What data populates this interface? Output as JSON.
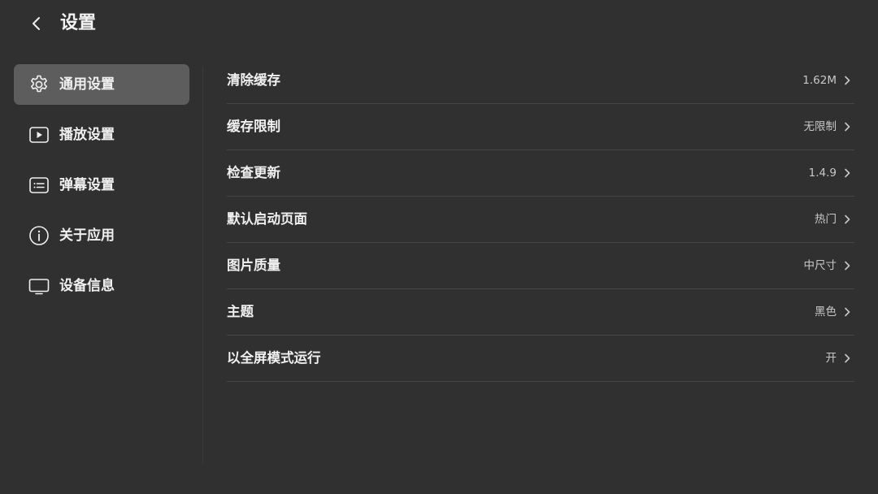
{
  "header": {
    "title": "设置"
  },
  "sidebar": {
    "items": [
      {
        "label": "通用设置",
        "icon": "gear-icon",
        "active": true
      },
      {
        "label": "播放设置",
        "icon": "play-icon",
        "active": false
      },
      {
        "label": "弹幕设置",
        "icon": "danmaku-icon",
        "active": false
      },
      {
        "label": "关于应用",
        "icon": "info-icon",
        "active": false
      },
      {
        "label": "设备信息",
        "icon": "monitor-icon",
        "active": false
      }
    ]
  },
  "settings": {
    "rows": [
      {
        "label": "清除缓存",
        "value": "1.62M"
      },
      {
        "label": "缓存限制",
        "value": "无限制"
      },
      {
        "label": "检查更新",
        "value": "1.4.9"
      },
      {
        "label": "默认启动页面",
        "value": "热门"
      },
      {
        "label": "图片质量",
        "value": "中尺寸"
      },
      {
        "label": "主题",
        "value": "黑色"
      },
      {
        "label": "以全屏模式运行",
        "value": "开"
      }
    ]
  },
  "colors": {
    "background": "#303030",
    "active_item": "#5d5d5d",
    "divider": "#464646",
    "text": "#f0f0f0",
    "secondary_text": "#c8c8c8"
  }
}
